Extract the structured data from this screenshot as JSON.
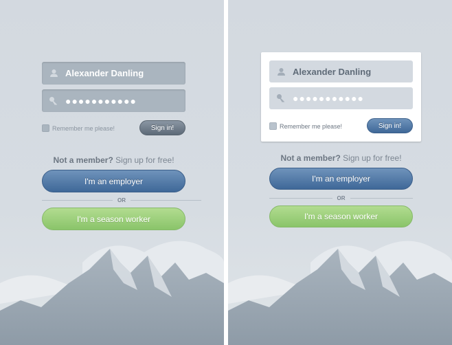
{
  "login": {
    "username": "Alexander Danling",
    "password_mask": "●●●●●●●●●●●",
    "remember_label": "Remember me please!",
    "remember_checked": false,
    "signin_label": "Sign in!"
  },
  "signup": {
    "prompt_bold": "Not a member?",
    "prompt_rest": " Sign up for free!",
    "employer_label": "I'm an employer",
    "or_label": "OR",
    "worker_label": "I'm a season worker"
  },
  "colors": {
    "employer": "#4f76a3",
    "worker": "#9ccf7b",
    "background": "#d3d9e0"
  },
  "icons": {
    "user": "user-icon",
    "password": "key-icon"
  }
}
